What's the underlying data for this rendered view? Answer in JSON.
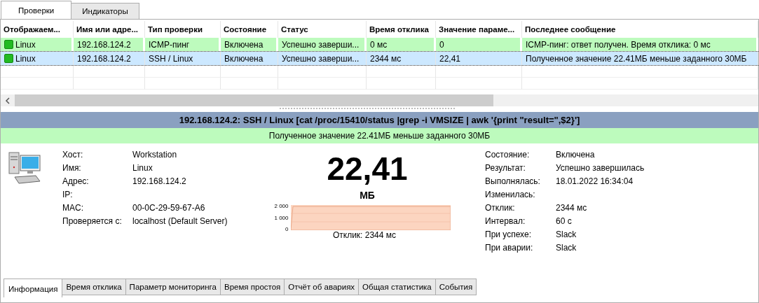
{
  "top_tabs": [
    {
      "label": "Проверки",
      "selected": true
    },
    {
      "label": "Индикаторы",
      "selected": false
    }
  ],
  "table": {
    "columns": [
      "Отображаем...",
      "Имя или адре...",
      "Тип проверки",
      "Состояние",
      "Статус",
      "Время отклика",
      "Значение параме...",
      "Последнее сообщение"
    ],
    "rows": [
      {
        "selected": false,
        "color": "#22bb22",
        "cells": [
          "Linux",
          "192.168.124.2",
          "ICMP-пинг",
          "Включена",
          "Успешно заверши...",
          "0 мс",
          "0",
          "ICMP-пинг: ответ получен. Время отклика: 0 мс"
        ]
      },
      {
        "selected": true,
        "color": "#22bb22",
        "cells": [
          "Linux",
          "192.168.124.2",
          "SSH / Linux",
          "Включена",
          "Успешно заверши...",
          "2344 мс",
          "22,41",
          "Полученное значение 22.41МБ меньше заданного 30МБ"
        ]
      }
    ]
  },
  "detail": {
    "title": "192.168.124.2: SSH / Linux [cat /proc/15410/status |grep -i VMSIZE | awk '{print \"result=\",$2}']",
    "message": "Полученное значение 22.41МБ меньше заданного 30МБ",
    "host_fields": [
      {
        "label": "Хост:",
        "value": "Workstation"
      },
      {
        "label": "Имя:",
        "value": "Linux"
      },
      {
        "label": "Адрес:",
        "value": "192.168.124.2"
      },
      {
        "label": "IP:"
      },
      {
        "label": "MAC:",
        "value": "00-0C-29-59-67-A6"
      },
      {
        "label": "Проверяется с:",
        "value": "localhost (Default Server)"
      }
    ],
    "value": "22,41",
    "unit": "МБ",
    "chart_axis_labels": [
      "2 000",
      "1 000",
      "0"
    ],
    "chart_caption": "Отклик: 2344 мс",
    "status_fields": [
      {
        "label": "Состояние:",
        "value": "Включена"
      },
      {
        "label": "Результат:",
        "value": "Успешно завершилась"
      },
      {
        "label": "Выполнялась:",
        "value": "18.01.2022 16:34:04"
      },
      {
        "label": "Изменилась:"
      },
      {
        "label": "Отклик:",
        "value": "2344 мс"
      },
      {
        "label": "Интервал:",
        "value": "60 с"
      },
      {
        "label": "При успехе:",
        "value": "Slack"
      },
      {
        "label": "При аварии:",
        "value": "Slack"
      }
    ]
  },
  "bottom_tabs": [
    {
      "label": "Информация",
      "selected": true
    },
    {
      "label": "Время отклика",
      "selected": false
    },
    {
      "label": "Параметр мониторинга",
      "selected": false
    },
    {
      "label": "Время простоя",
      "selected": false
    },
    {
      "label": "Отчёт об авариях",
      "selected": false
    },
    {
      "label": "Общая статистика",
      "selected": false
    },
    {
      "label": "События",
      "selected": false
    }
  ]
}
